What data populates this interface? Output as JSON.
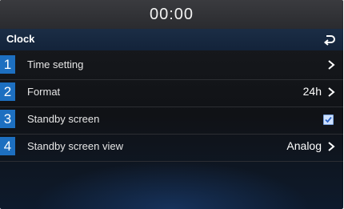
{
  "status": {
    "time": "00:00"
  },
  "header": {
    "title": "Clock"
  },
  "items": [
    {
      "number": "1",
      "label": "Time setting",
      "value": ""
    },
    {
      "number": "2",
      "label": "Format",
      "value": "24h"
    },
    {
      "number": "3",
      "label": "Standby screen",
      "value": "",
      "checked": true
    },
    {
      "number": "4",
      "label": "Standby screen view",
      "value": "Analog"
    }
  ],
  "icons": {
    "back": "back-return-icon",
    "chevron": "chevron-right-icon",
    "checkbox": "checkbox-checked-icon"
  },
  "colors": {
    "badge": "#1d6fc0",
    "title_bar": "#1b2d45",
    "status_bar": "#2f3034"
  }
}
